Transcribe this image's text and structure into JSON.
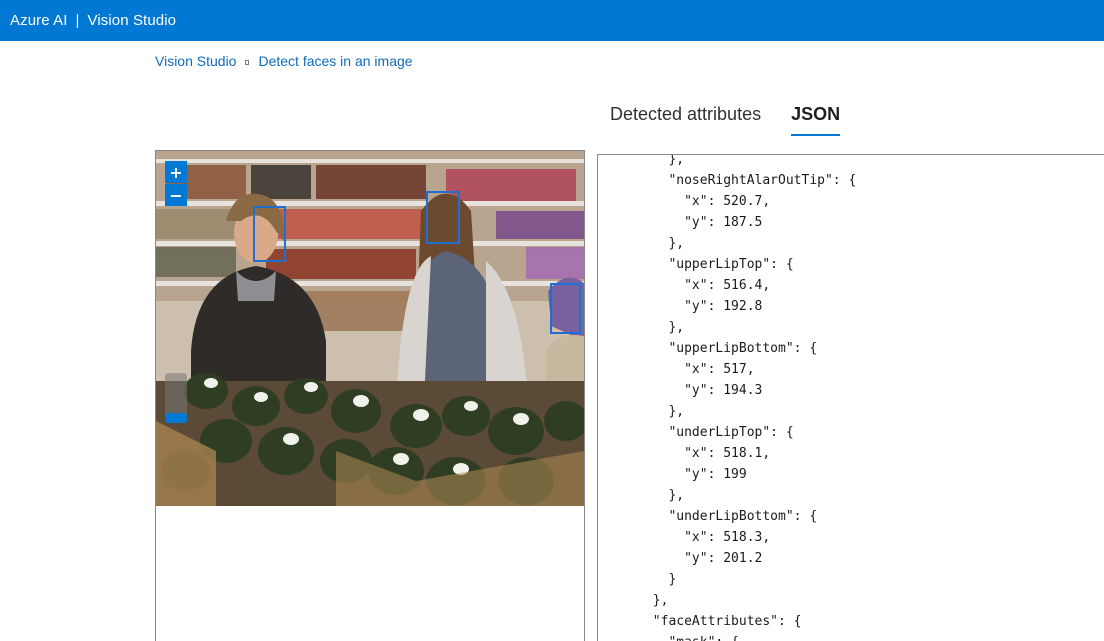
{
  "header": {
    "brand": "Azure AI",
    "separator": "|",
    "product": "Vision Studio"
  },
  "breadcrumb": {
    "items": [
      "Vision Studio",
      "Detect faces in an image"
    ]
  },
  "tabs": [
    {
      "label": "Detected attributes",
      "active": false
    },
    {
      "label": "JSON",
      "active": true
    }
  ],
  "image_viewer": {
    "zoom_in_label": "+",
    "zoom_out_label": "−",
    "detected_faces_count": 3
  },
  "json_view": {
    "lines": [
      "    },",
      "    \"noseRightAlarOutTip\": {",
      "      \"x\": 520.7,",
      "      \"y\": 187.5",
      "    },",
      "    \"upperLipTop\": {",
      "      \"x\": 516.4,",
      "      \"y\": 192.8",
      "    },",
      "    \"upperLipBottom\": {",
      "      \"x\": 517,",
      "      \"y\": 194.3",
      "    },",
      "    \"underLipTop\": {",
      "      \"x\": 518.1,",
      "      \"y\": 199",
      "    },",
      "    \"underLipBottom\": {",
      "      \"x\": 518.3,",
      "      \"y\": 201.2",
      "    }",
      "  },",
      "  \"faceAttributes\": {",
      "    \"mask\": {"
    ]
  },
  "colors": {
    "accent": "#0078d4",
    "face_box": "#1f6fd1",
    "link": "#0f6cbd"
  }
}
